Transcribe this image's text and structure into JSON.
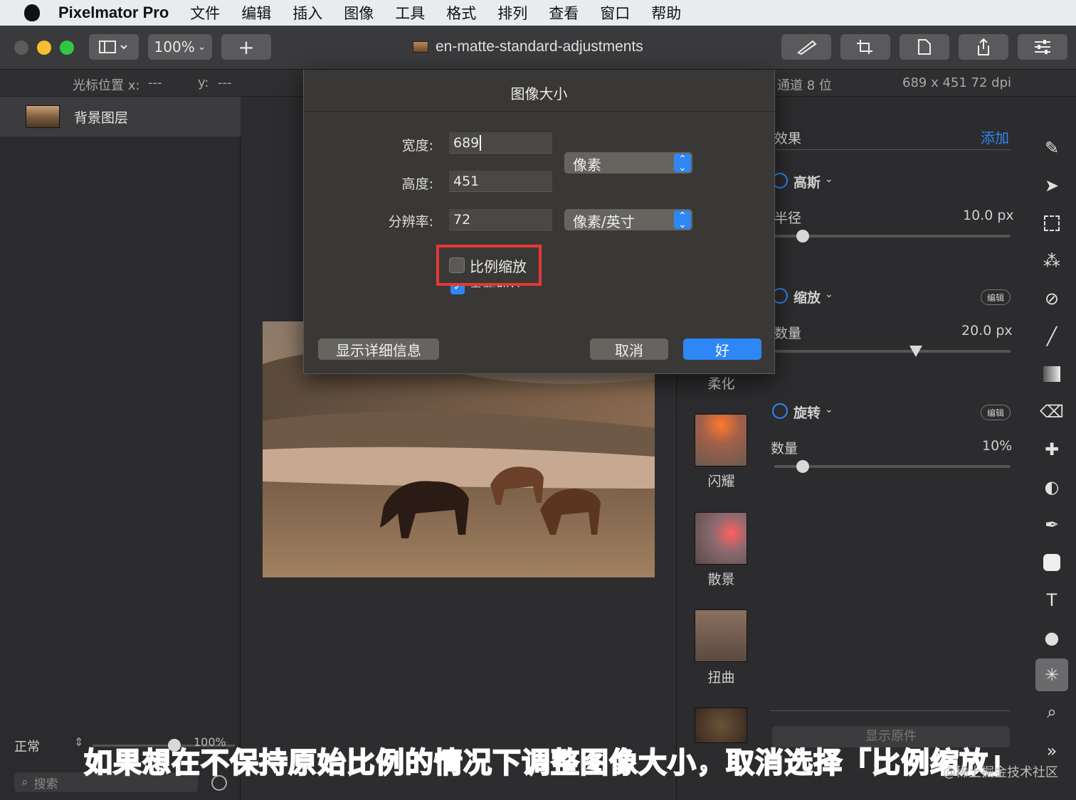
{
  "menubar": {
    "app_name": "Pixelmator Pro",
    "items": [
      "文件",
      "编辑",
      "插入",
      "图像",
      "工具",
      "格式",
      "排列",
      "查看",
      "窗口",
      "帮助"
    ]
  },
  "toolbar": {
    "zoom": "100%",
    "add_label": "+",
    "document_title": "en-matte-standard-adjustments"
  },
  "infobar": {
    "cursor_label": "光标位置 x:",
    "cursor_x": "---",
    "y_label": "y:",
    "cursor_y": "---",
    "channel_info": "通道 8 位",
    "size_info": "689 x 451 72 dpi"
  },
  "layers": {
    "background_layer": "背景图层",
    "blend_mode": "正常",
    "opacity": "100%",
    "search_placeholder": "搜索"
  },
  "dialog": {
    "title": "图像大小",
    "width_label": "宽度:",
    "width_value": "689",
    "height_label": "高度:",
    "height_value": "451",
    "resolution_label": "分辨率:",
    "resolution_value": "72",
    "unit_size": "像素",
    "unit_resolution": "像素/英寸",
    "scale_proportionally": "比例缩放",
    "resample": "重新取样",
    "show_details": "显示详细信息",
    "cancel": "取消",
    "ok": "好"
  },
  "effects_browser": {
    "items": [
      "柔化",
      "闪耀",
      "散景",
      "扭曲"
    ]
  },
  "effects_panel": {
    "header": "效果",
    "add": "添加",
    "edit": "编辑",
    "gaussian": {
      "name": "高斯",
      "param": "半径",
      "value": "10.0 px",
      "level": 0.12
    },
    "zoom": {
      "name": "缩放",
      "param": "数量",
      "value": "20.0 px",
      "level": 0.6
    },
    "spin": {
      "name": "旋转",
      "param": "数量",
      "value": "10%",
      "level": 0.12
    },
    "show_original": "显示原件"
  },
  "caption": "如果想在不保持原始比例的情况下调整图像大小，取消选择「比例缩放」",
  "watermark": "@稀土掘金技术社区",
  "colors": {
    "accent": "#2f86f5",
    "highlight_box": "#e53935",
    "caption_red": "#e43b3b"
  }
}
